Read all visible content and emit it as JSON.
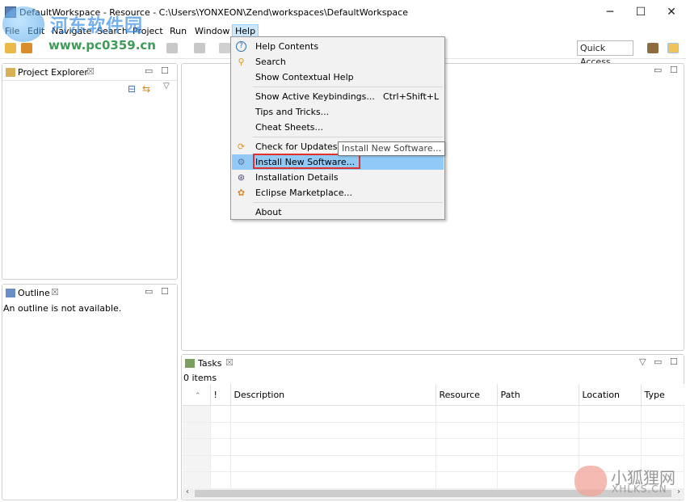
{
  "window": {
    "title": "DefaultWorkspace - Resource - C:\\Users\\YONXEON\\Zend\\workspaces\\DefaultWorkspace",
    "min": "─",
    "max": "☐",
    "close": "✕"
  },
  "menubar": {
    "items": [
      "File",
      "Edit",
      "Navigate",
      "Search",
      "Project",
      "Run",
      "Window",
      "Help"
    ]
  },
  "toolbar": {
    "quick_access": "Quick Access"
  },
  "watermark": {
    "cn": "河东软件园",
    "url": "www.pc0359.cn",
    "fox_cn": "小狐狸网",
    "fox_en": "XHLKS.CN"
  },
  "project_explorer": {
    "title": "Project Explorer",
    "close": "☒"
  },
  "outline": {
    "title": "Outline",
    "close": "☒",
    "message": "An outline is not available."
  },
  "tasks": {
    "title": "Tasks",
    "close": "☒",
    "count": "0 items",
    "columns": [
      "",
      "!",
      "Description",
      "Resource",
      "Path",
      "Location",
      "Type"
    ]
  },
  "help_menu": {
    "items": [
      {
        "label": "Help Contents",
        "icon": "help-contents-icon",
        "glyph": "?"
      },
      {
        "label": "Search",
        "icon": "search-icon",
        "glyph": "⚲"
      },
      {
        "label": "Show Contextual Help",
        "icon": "",
        "glyph": ""
      },
      {
        "label": "Show Active Keybindings...",
        "accel": "Ctrl+Shift+L"
      },
      {
        "label": "Tips and Tricks..."
      },
      {
        "label": "Cheat Sheets..."
      },
      {
        "label": "Check for Updates",
        "icon": "updates-icon",
        "glyph": "⟳"
      },
      {
        "label": "Install New Software...",
        "icon": "install-icon",
        "glyph": "⚙"
      },
      {
        "label": "Installation Details",
        "icon": "details-icon",
        "glyph": "⊛"
      },
      {
        "label": "Eclipse Marketplace...",
        "icon": "marketplace-icon",
        "glyph": "✿"
      },
      {
        "label": "About"
      }
    ]
  },
  "tooltip": "Install New Software...",
  "colors": {
    "menu_highlight": "#91c9f7",
    "annotation_red": "#e0312b"
  }
}
